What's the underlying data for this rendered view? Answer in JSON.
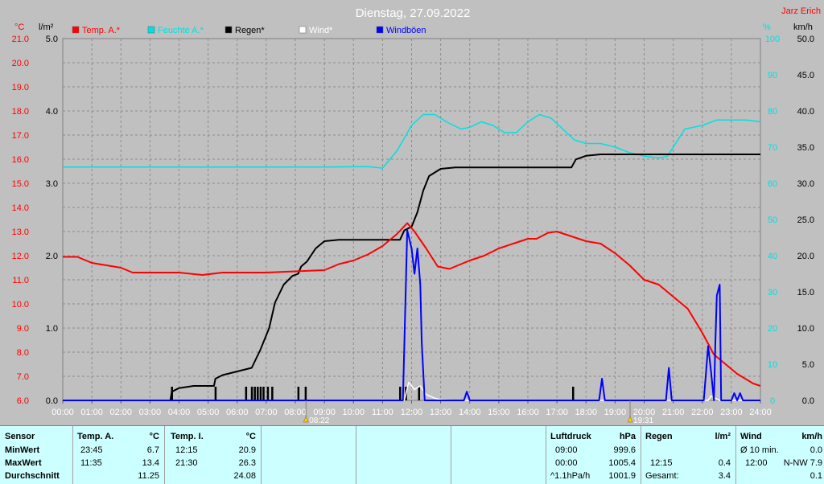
{
  "header": {
    "title": "Dienstag, 27.09.2022",
    "brand": "Jarz Erich"
  },
  "colors": {
    "temp": "#ff0000",
    "humidity": "#00e0e0",
    "rain": "#000000",
    "wind": "#ffffff",
    "gust": "#0000ff",
    "rain_bar": "#000000"
  },
  "chart_data": {
    "type": "line",
    "x_tick_labels": [
      "00:00",
      "01:00",
      "02:00",
      "03:00",
      "04:00",
      "05:00",
      "06:00",
      "07:00",
      "08:00",
      "09:00",
      "10:00",
      "11:00",
      "12:00",
      "13:00",
      "14:00",
      "15:00",
      "16:00",
      "17:00",
      "18:00",
      "19:00",
      "20:00",
      "21:00",
      "22:00",
      "23:00",
      "24:00"
    ],
    "xlim": [
      0,
      24
    ],
    "axes": {
      "temp": {
        "unit": "°C",
        "range": [
          6.0,
          21.0
        ],
        "ticks": [
          "6.0",
          "7.0",
          "8.0",
          "9.0",
          "10.0",
          "11.0",
          "12.0",
          "13.0",
          "14.0",
          "15.0",
          "16.0",
          "17.0",
          "18.0",
          "19.0",
          "20.0",
          "21.0"
        ]
      },
      "rain": {
        "unit": "l/m²",
        "range": [
          0.0,
          5.0
        ],
        "ticks": [
          "0.0",
          "1.0",
          "2.0",
          "3.0",
          "4.0",
          "5.0"
        ]
      },
      "humidity": {
        "unit": "%",
        "range": [
          0,
          100
        ],
        "ticks": [
          "0",
          "10",
          "20",
          "30",
          "40",
          "50",
          "60",
          "70",
          "80",
          "90",
          "100"
        ]
      },
      "wind": {
        "unit": "km/h",
        "range": [
          0.0,
          50.0
        ],
        "ticks": [
          "0.0",
          "5.0",
          "10.0",
          "15.0",
          "20.0",
          "25.0",
          "30.0",
          "35.0",
          "40.0",
          "45.0",
          "50.0"
        ]
      }
    },
    "legend": [
      {
        "label": "Temp. A.*",
        "color": "#ff0000"
      },
      {
        "label": "Feuchte A.*",
        "color": "#00e0e0"
      },
      {
        "label": "Regen*",
        "color": "#000000"
      },
      {
        "label": "Wind*",
        "color": "#ffffff"
      },
      {
        "label": "Windböen",
        "color": "#0000ff"
      }
    ],
    "series": [
      {
        "name": "Temp. A.*",
        "axis": "temp",
        "points": [
          [
            0,
            11.95
          ],
          [
            0.5,
            11.95
          ],
          [
            1,
            11.7
          ],
          [
            1.5,
            11.6
          ],
          [
            2,
            11.5
          ],
          [
            2.4,
            11.3
          ],
          [
            3,
            11.3
          ],
          [
            4,
            11.3
          ],
          [
            4.8,
            11.2
          ],
          [
            5.5,
            11.3
          ],
          [
            6,
            11.3
          ],
          [
            7,
            11.3
          ],
          [
            8,
            11.35
          ],
          [
            9,
            11.4
          ],
          [
            9.5,
            11.65
          ],
          [
            10,
            11.8
          ],
          [
            10.5,
            12.05
          ],
          [
            11,
            12.4
          ],
          [
            11.5,
            12.9
          ],
          [
            11.85,
            13.35
          ],
          [
            12.1,
            13.0
          ],
          [
            12.5,
            12.3
          ],
          [
            12.9,
            11.55
          ],
          [
            13.3,
            11.45
          ],
          [
            13.6,
            11.6
          ],
          [
            14,
            11.8
          ],
          [
            14.5,
            12.0
          ],
          [
            15,
            12.3
          ],
          [
            15.5,
            12.5
          ],
          [
            16,
            12.7
          ],
          [
            16.3,
            12.7
          ],
          [
            16.7,
            12.95
          ],
          [
            17,
            13.0
          ],
          [
            17.5,
            12.8
          ],
          [
            18,
            12.6
          ],
          [
            18.5,
            12.5
          ],
          [
            19,
            12.1
          ],
          [
            19.5,
            11.6
          ],
          [
            20,
            11.0
          ],
          [
            20.5,
            10.8
          ],
          [
            21,
            10.3
          ],
          [
            21.5,
            9.8
          ],
          [
            22,
            8.8
          ],
          [
            22.4,
            7.9
          ],
          [
            22.8,
            7.5
          ],
          [
            23.2,
            7.1
          ],
          [
            23.75,
            6.7
          ],
          [
            24,
            6.6
          ]
        ]
      },
      {
        "name": "Feuchte A.*",
        "axis": "humidity",
        "points": [
          [
            0,
            64.5
          ],
          [
            5,
            64.5
          ],
          [
            9,
            64.5
          ],
          [
            10.5,
            64.6
          ],
          [
            11,
            64.2
          ],
          [
            11.5,
            69
          ],
          [
            12,
            76
          ],
          [
            12.4,
            79
          ],
          [
            12.8,
            79
          ],
          [
            13.2,
            77
          ],
          [
            13.7,
            75
          ],
          [
            14,
            75.5
          ],
          [
            14.4,
            77
          ],
          [
            14.8,
            76
          ],
          [
            15.2,
            74
          ],
          [
            15.6,
            74
          ],
          [
            16,
            77
          ],
          [
            16.4,
            79
          ],
          [
            16.8,
            78
          ],
          [
            17.2,
            75
          ],
          [
            17.6,
            72
          ],
          [
            18,
            71
          ],
          [
            18.5,
            71
          ],
          [
            19,
            70
          ],
          [
            19.5,
            68.5
          ],
          [
            20,
            67.5
          ],
          [
            20.5,
            67
          ],
          [
            20.8,
            67.5
          ],
          [
            21,
            70
          ],
          [
            21.4,
            75
          ],
          [
            22,
            76
          ],
          [
            22.5,
            77.5
          ],
          [
            23,
            77.5
          ],
          [
            23.5,
            77.5
          ],
          [
            24,
            77
          ]
        ]
      },
      {
        "name": "Regen*",
        "axis": "rain",
        "points": [
          [
            0,
            0
          ],
          [
            3.7,
            0
          ],
          [
            3.75,
            0.12
          ],
          [
            4,
            0.17
          ],
          [
            4.5,
            0.2
          ],
          [
            5.2,
            0.2
          ],
          [
            5.25,
            0.3
          ],
          [
            5.5,
            0.35
          ],
          [
            6,
            0.4
          ],
          [
            6.5,
            0.45
          ],
          [
            6.8,
            0.7
          ],
          [
            7.1,
            1.0
          ],
          [
            7.3,
            1.35
          ],
          [
            7.6,
            1.6
          ],
          [
            7.9,
            1.72
          ],
          [
            8.1,
            1.75
          ],
          [
            8.2,
            1.85
          ],
          [
            8.4,
            1.92
          ],
          [
            8.7,
            2.1
          ],
          [
            9,
            2.2
          ],
          [
            9.5,
            2.22
          ],
          [
            10,
            2.22
          ],
          [
            11,
            2.22
          ],
          [
            11.6,
            2.22
          ],
          [
            11.75,
            2.35
          ],
          [
            12,
            2.4
          ],
          [
            12.2,
            2.6
          ],
          [
            12.4,
            2.9
          ],
          [
            12.6,
            3.1
          ],
          [
            13,
            3.2
          ],
          [
            13.5,
            3.22
          ],
          [
            14,
            3.22
          ],
          [
            16,
            3.22
          ],
          [
            17.5,
            3.22
          ],
          [
            17.65,
            3.33
          ],
          [
            18,
            3.38
          ],
          [
            18.5,
            3.4
          ],
          [
            19,
            3.4
          ],
          [
            20,
            3.4
          ],
          [
            24,
            3.4
          ]
        ]
      },
      {
        "name": "Wind*",
        "axis": "wind",
        "points": [
          [
            0,
            0
          ],
          [
            11.75,
            0
          ],
          [
            11.9,
            2.5
          ],
          [
            12.1,
            1.5
          ],
          [
            12.3,
            2.0
          ],
          [
            12.5,
            0.8
          ],
          [
            12.8,
            0.3
          ],
          [
            13,
            0.1
          ],
          [
            13.5,
            0
          ],
          [
            22.2,
            0
          ],
          [
            22.3,
            0.6
          ],
          [
            22.5,
            0.2
          ],
          [
            22.6,
            0
          ],
          [
            24,
            0
          ]
        ]
      },
      {
        "name": "Windböen",
        "axis": "wind",
        "points": [
          [
            0,
            0
          ],
          [
            11.7,
            0
          ],
          [
            11.85,
            23.5
          ],
          [
            12.0,
            21.0
          ],
          [
            12.1,
            17.5
          ],
          [
            12.2,
            21.0
          ],
          [
            12.3,
            16.0
          ],
          [
            12.35,
            8.0
          ],
          [
            12.45,
            0
          ],
          [
            13.8,
            0
          ],
          [
            13.9,
            1.2
          ],
          [
            14.0,
            0
          ],
          [
            18.45,
            0
          ],
          [
            18.55,
            3.0
          ],
          [
            18.65,
            0
          ],
          [
            20.75,
            0
          ],
          [
            20.85,
            4.5
          ],
          [
            20.95,
            0
          ],
          [
            22.05,
            0
          ],
          [
            22.2,
            7.5
          ],
          [
            22.3,
            4.0
          ],
          [
            22.4,
            0
          ],
          [
            22.45,
            8.0
          ],
          [
            22.5,
            14.5
          ],
          [
            22.6,
            16.0
          ],
          [
            22.65,
            0
          ],
          [
            23.0,
            0
          ],
          [
            23.1,
            1.0
          ],
          [
            23.2,
            0
          ],
          [
            23.3,
            1.0
          ],
          [
            23.4,
            0
          ],
          [
            24,
            0
          ]
        ]
      }
    ],
    "rain_bars_hours": [
      3.75,
      5.25,
      6.3,
      6.5,
      6.6,
      6.7,
      6.8,
      6.9,
      7.05,
      7.2,
      8.1,
      8.35,
      11.6,
      11.8,
      12.25,
      17.55
    ]
  },
  "markers": {
    "sunrise": "08:22",
    "sunset": "19:31"
  },
  "stats": {
    "sensor": {
      "header": "Sensor",
      "rows": [
        "MinWert",
        "MaxWert",
        "Durchschnitt"
      ]
    },
    "temp_a": {
      "header": "Temp. A.",
      "unit": "°C",
      "min_time": "23:45",
      "min_val": "6.7",
      "max_time": "11:35",
      "max_val": "13.4",
      "avg": "11.25"
    },
    "temp_i": {
      "header": "Temp. I.",
      "unit": "°C",
      "min_time": "12:15",
      "min_val": "20.9",
      "max_time": "21:30",
      "max_val": "26.3",
      "avg": "24.08"
    },
    "pressure": {
      "header": "Luftdruck",
      "unit": "hPa",
      "min_time": "09:00",
      "min_val": "999.6",
      "max_time": "00:00",
      "max_val": "1005.4",
      "trend": "^1.1hPa/h",
      "avg": "1001.9"
    },
    "rain": {
      "header": "Regen",
      "unit": "l/m²",
      "max_time": "12:15",
      "max_val": "0.4",
      "total_label": "Gesamt:",
      "total": "3.4"
    },
    "wind": {
      "header": "Wind",
      "unit": "km/h",
      "avg_label": "Ø 10 min.",
      "avg_val": "0.0",
      "max_time": "12:00",
      "max_val": "N-NW 7.9",
      "day_avg": "0.1"
    }
  }
}
